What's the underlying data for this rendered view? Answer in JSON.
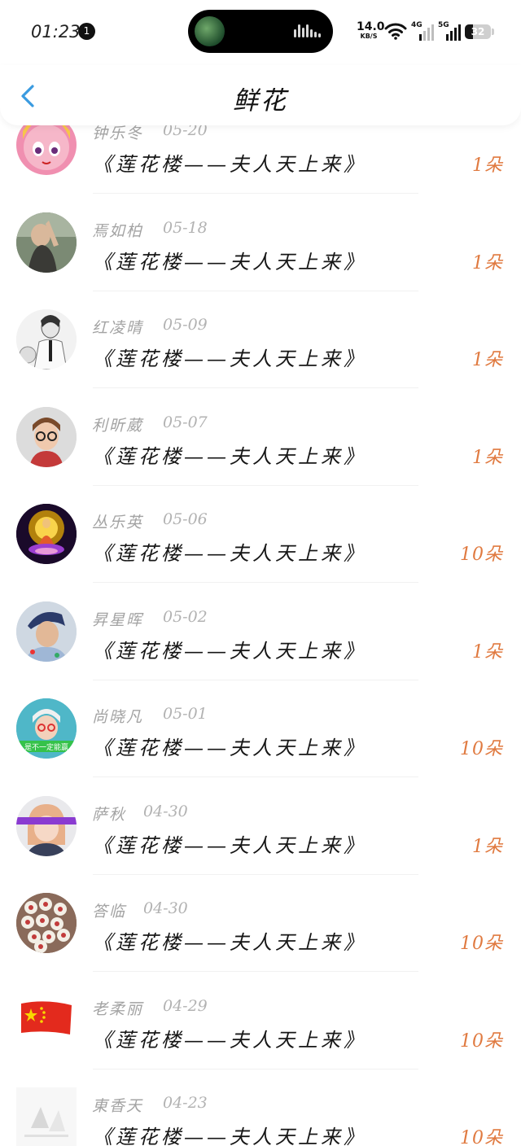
{
  "status_bar": {
    "time": "01:23",
    "notification_count": "1",
    "net_speed_value": "14.0",
    "net_speed_unit": "KB/S",
    "network_label_1": "4G",
    "network_label_2": "5G",
    "battery_level": "32"
  },
  "header": {
    "back_icon": "chevron-left-icon",
    "title": "鲜花"
  },
  "colors": {
    "accent_back": "#3a9be0",
    "count_color": "#e07a40",
    "name_color": "#a3a3a3",
    "date_color": "#b2b2b2"
  },
  "gifts": [
    {
      "name": "钟乐冬",
      "date": "05-20",
      "title": "《莲花楼——夫人天上来》",
      "count": "1朵",
      "avatar": "anime-girl"
    },
    {
      "name": "焉如柏",
      "date": "05-18",
      "title": "《莲花楼——夫人天上来》",
      "count": "1朵",
      "avatar": "photo-person"
    },
    {
      "name": "红凌晴",
      "date": "05-09",
      "title": "《莲花楼——夫人天上来》",
      "count": "1朵",
      "avatar": "sketch-man"
    },
    {
      "name": "利昕葳",
      "date": "05-07",
      "title": "《莲花楼——夫人天上来》",
      "count": "1朵",
      "avatar": "person-glasses"
    },
    {
      "name": "丛乐英",
      "date": "05-06",
      "title": "《莲花楼——夫人天上来》",
      "count": "10朵",
      "avatar": "buddha"
    },
    {
      "name": "昇星晖",
      "date": "05-02",
      "title": "《莲花楼——夫人天上来》",
      "count": "1朵",
      "avatar": "young-man"
    },
    {
      "name": "尚晓凡",
      "date": "05-01",
      "title": "《莲花楼——夫人天上来》",
      "count": "10朵",
      "avatar": "girl-banner",
      "avatar_caption": "是不一定能赢"
    },
    {
      "name": "萨秋",
      "date": "04-30",
      "title": "《莲花楼——夫人天上来》",
      "count": "1朵",
      "avatar": "girl-bar"
    },
    {
      "name": "答临",
      "date": "04-30",
      "title": "《莲花楼——夫人天上来》",
      "count": "10朵",
      "avatar": "flowers"
    },
    {
      "name": "老柔丽",
      "date": "04-29",
      "title": "《莲花楼——夫人天上来》",
      "count": "10朵",
      "avatar": "china-flag"
    },
    {
      "name": "東香天",
      "date": "04-23",
      "title": "《莲花楼——夫人天上来》",
      "count": "10朵",
      "avatar": "light-sketch"
    }
  ]
}
